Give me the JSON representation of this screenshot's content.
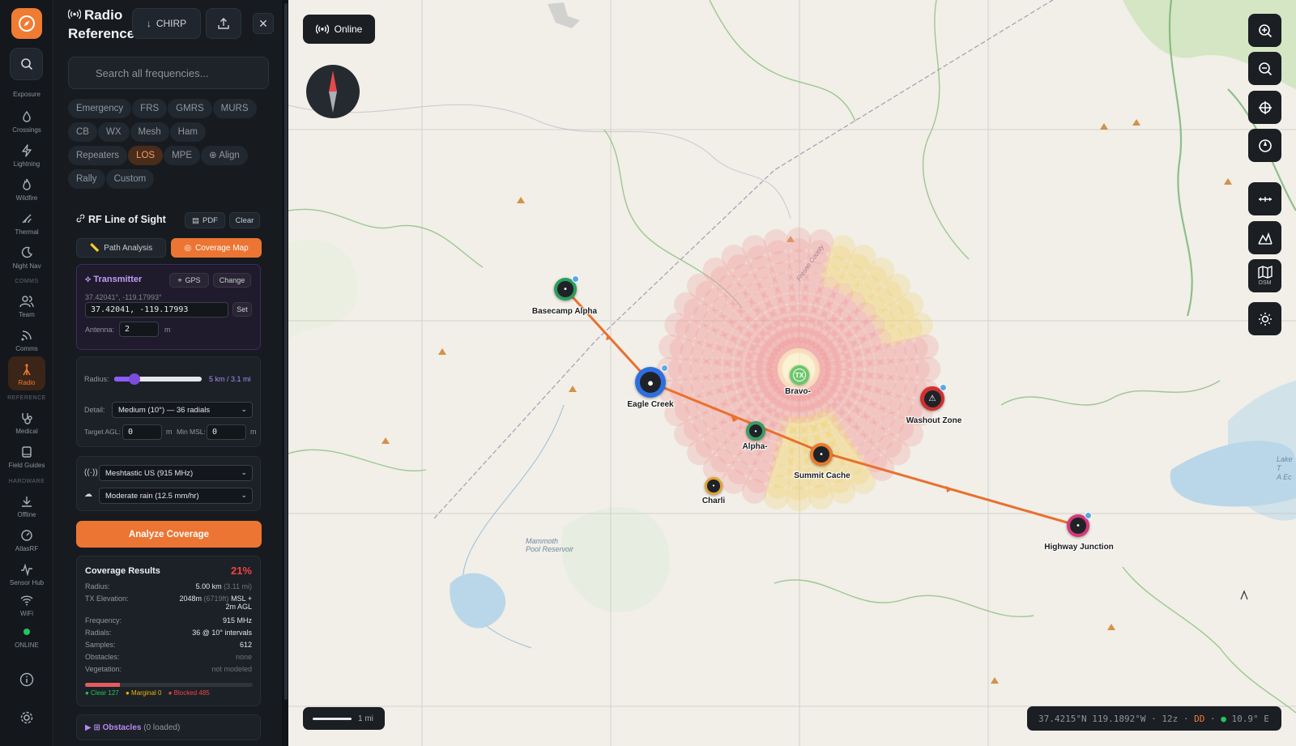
{
  "rail": {
    "items": [
      {
        "label": "Exposure",
        "icon": "exposure-icon"
      },
      {
        "label": "Crossings",
        "icon": "drop-icon"
      },
      {
        "label": "Lightning",
        "icon": "lightning-icon"
      },
      {
        "label": "Wildfire",
        "icon": "flame-icon"
      },
      {
        "label": "Thermal",
        "icon": "thermal-icon"
      },
      {
        "label": "Night Nav",
        "icon": "moon-icon"
      },
      {
        "label": "Team",
        "icon": "team-icon"
      },
      {
        "label": "Comms",
        "icon": "signal-icon"
      },
      {
        "label": "Radio",
        "icon": "antenna-icon"
      },
      {
        "label": "Medical",
        "icon": "stethoscope-icon"
      },
      {
        "label": "Field Guides",
        "icon": "book-icon"
      },
      {
        "label": "Offline",
        "icon": "download-icon"
      },
      {
        "label": "AtlasRF",
        "icon": "gauge-icon"
      },
      {
        "label": "Sensor Hub",
        "icon": "pulse-icon"
      },
      {
        "label": "WiFi",
        "icon": "wifi-icon"
      },
      {
        "label": "ONLINE",
        "icon": "status-dot-icon"
      }
    ],
    "sections": {
      "comms": "COMMS",
      "reference": "REFERENCE",
      "hardware": "HARDWARE"
    }
  },
  "panel": {
    "title_line1": "Radio",
    "title_line2": "Reference",
    "chirp_label": "CHIRP",
    "search_placeholder": "Search all frequencies...",
    "chips": [
      "Emergency",
      "FRS",
      "GMRS",
      "MURS",
      "CB",
      "WX",
      "Mesh",
      "Ham",
      "Repeaters",
      "LOS",
      "MPE",
      "⊕ Align",
      "Rally",
      "Custom"
    ],
    "active_chip": "LOS",
    "los": {
      "title": "RF Line of Sight",
      "pdf_label": "PDF",
      "clear_label": "Clear",
      "tab_path": "Path Analysis",
      "tab_coverage": "Coverage Map"
    },
    "transmitter": {
      "title": "Transmitter",
      "gps_label": "GPS",
      "change_label": "Change",
      "coords_display": "37.42041°, -119.17993°",
      "coords_input": "37.42041, -119.17993",
      "set_label": "Set",
      "antenna_label": "Antenna:",
      "antenna_value": "2",
      "antenna_unit": "m"
    },
    "radius": {
      "label": "Radius:",
      "value_text": "5 km / 3.1 mi",
      "slider_fraction": 0.2,
      "detail_label": "Detail:",
      "detail_value": "Medium (10°) — 36 radials",
      "target_agl_label": "Target AGL:",
      "target_agl_value": "0",
      "min_msl_label": "Min MSL:",
      "min_msl_value": "0",
      "unit": "m"
    },
    "device": {
      "radio_value": "Meshtastic US (915 MHz)",
      "weather_value": "Moderate rain (12.5 mm/hr)"
    },
    "analyze_label": "Analyze Coverage",
    "results": {
      "title": "Coverage Results",
      "percent": "21%",
      "rows": [
        {
          "label": "Radius:",
          "value": "5.00 km",
          "dim": "(3.11 mi)"
        },
        {
          "label": "TX Elevation:",
          "value": "2048m",
          "dim": "(6719ft)",
          "value2": "MSL +",
          "value3": "2m AGL"
        },
        {
          "label": "Frequency:",
          "value": "915 MHz"
        },
        {
          "label": "Radials:",
          "value": "36 @ 10° intervals"
        },
        {
          "label": "Samples:",
          "value": "612"
        },
        {
          "label": "Obstacles:",
          "value": "none"
        },
        {
          "label": "Vegetation:",
          "value": "not modeled"
        }
      ],
      "clear_fraction": 0.21,
      "legend_clear": "● Clear 127",
      "legend_marginal": "● Marginal 0",
      "legend_blocked": "● Blocked 485"
    },
    "obstacles": {
      "title": "Obstacles",
      "count": "(0 loaded)"
    }
  },
  "map": {
    "online_label": "Online",
    "osm_label": "OSM",
    "scale_label": "1 mi",
    "coord_text": "37.4215°N 119.1892°W",
    "zoom_text": "12z",
    "format_text": "DD",
    "declination_text": "10.9° E",
    "reservoir_name_1": "Mammoth",
    "reservoir_name_2": "Pool Reservoir",
    "county_label": "Fresno County",
    "lake_label_1": "Lake T",
    "lake_label_2": "A Ec",
    "waypoints": [
      {
        "name": "Basecamp Alpha",
        "color": "#2a9d5c"
      },
      {
        "name": "Eagle Creek",
        "color": "#2d6fe0"
      },
      {
        "name": "Bravo-",
        "color": "#6bc76b",
        "badge": "TX"
      },
      {
        "name": "Alpha-",
        "color": "#3d9a64"
      },
      {
        "name": "Summit Cache",
        "color": "#e87a2c"
      },
      {
        "name": "Charli",
        "color": "#e0a030"
      },
      {
        "name": "Washout Zone",
        "color": "#d03030"
      },
      {
        "name": "Highway Junction",
        "color": "#d6387a"
      }
    ],
    "route_color": "#e8702e"
  },
  "colors": {
    "accent": "#ec7533",
    "purple": "#8b5cf6",
    "blocked": "#ef4444",
    "clear": "#22c55e",
    "marginal": "#eab308"
  }
}
